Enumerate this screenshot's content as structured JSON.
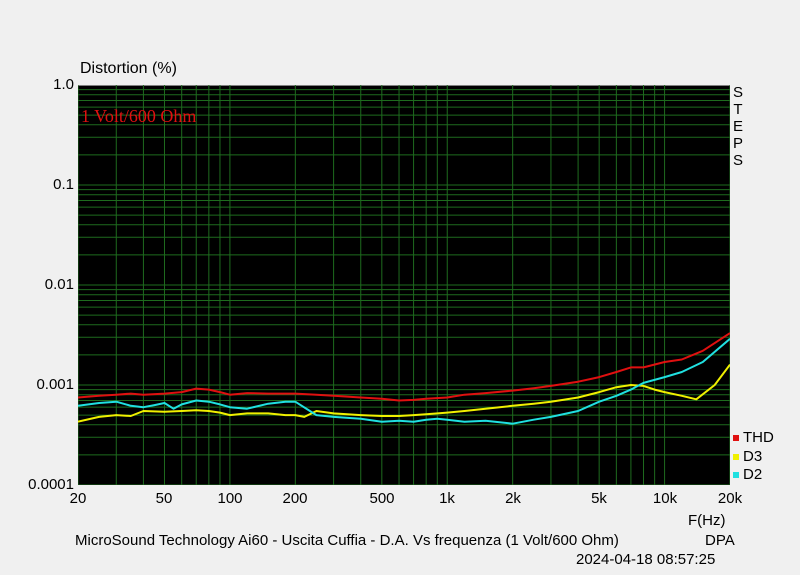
{
  "chart_data": {
    "type": "line",
    "title": "Distortion (%)",
    "annotation": "1 Volt/600 Ohm",
    "xlabel": "F(Hz)",
    "yscale": "log",
    "xscale": "log",
    "xlim": [
      20,
      20000
    ],
    "ylim": [
      0.0001,
      1.0
    ],
    "grid": true,
    "background": "#000000",
    "grid_color": "#1e6b1e",
    "legend_position": "right-bottom",
    "y_ticks": [
      "1.0",
      "0.1",
      "0.01",
      "0.001",
      "0.0001"
    ],
    "x_ticks": [
      "20",
      "50",
      "100",
      "200",
      "500",
      "1k",
      "2k",
      "5k",
      "10k",
      "20k"
    ],
    "x_tick_values": [
      20,
      50,
      100,
      200,
      500,
      1000,
      2000,
      5000,
      10000,
      20000
    ],
    "series": [
      {
        "name": "THD",
        "color": "#e01010",
        "x": [
          20,
          25,
          30,
          35,
          40,
          50,
          60,
          70,
          80,
          90,
          100,
          120,
          150,
          200,
          250,
          300,
          400,
          500,
          600,
          700,
          800,
          1000,
          1200,
          1500,
          2000,
          2500,
          3000,
          4000,
          5000,
          6000,
          7000,
          8000,
          10000,
          12000,
          15000,
          20000
        ],
        "y": [
          0.00075,
          0.00078,
          0.0008,
          0.00082,
          0.0008,
          0.00082,
          0.00085,
          0.00092,
          0.0009,
          0.00085,
          0.0008,
          0.00083,
          0.00082,
          0.00082,
          0.0008,
          0.00078,
          0.00075,
          0.00073,
          0.0007,
          0.00071,
          0.00073,
          0.00075,
          0.0008,
          0.00083,
          0.00088,
          0.00093,
          0.00098,
          0.00108,
          0.0012,
          0.00135,
          0.0015,
          0.0015,
          0.0017,
          0.0018,
          0.0022,
          0.0033
        ]
      },
      {
        "name": "D3",
        "color": "#f0f000",
        "x": [
          20,
          25,
          30,
          35,
          40,
          50,
          60,
          70,
          80,
          90,
          100,
          120,
          150,
          180,
          200,
          220,
          250,
          300,
          400,
          500,
          600,
          700,
          800,
          1000,
          1200,
          1500,
          2000,
          2500,
          3000,
          4000,
          5000,
          6000,
          7000,
          8000,
          9000,
          10000,
          12000,
          14000,
          17000,
          20000
        ],
        "y": [
          0.00043,
          0.00048,
          0.0005,
          0.00049,
          0.00055,
          0.00054,
          0.00055,
          0.00056,
          0.00055,
          0.00053,
          0.0005,
          0.00052,
          0.00052,
          0.0005,
          0.0005,
          0.00048,
          0.00055,
          0.00052,
          0.0005,
          0.00049,
          0.00049,
          0.0005,
          0.00051,
          0.00053,
          0.00055,
          0.00058,
          0.00062,
          0.00065,
          0.00068,
          0.00075,
          0.00085,
          0.00095,
          0.001,
          0.00098,
          0.0009,
          0.00085,
          0.00078,
          0.00072,
          0.001,
          0.0016
        ]
      },
      {
        "name": "D2",
        "color": "#20e0e0",
        "x": [
          20,
          25,
          30,
          35,
          40,
          45,
          50,
          55,
          60,
          70,
          80,
          90,
          100,
          120,
          150,
          180,
          200,
          250,
          300,
          400,
          500,
          600,
          700,
          800,
          900,
          1000,
          1200,
          1500,
          2000,
          2500,
          3000,
          4000,
          5000,
          6000,
          7000,
          8000,
          10000,
          12000,
          15000,
          20000
        ],
        "y": [
          0.00062,
          0.00066,
          0.00068,
          0.00062,
          0.0006,
          0.00063,
          0.00066,
          0.00058,
          0.00064,
          0.0007,
          0.00068,
          0.00064,
          0.0006,
          0.00058,
          0.00065,
          0.00068,
          0.00068,
          0.0005,
          0.00048,
          0.00046,
          0.00043,
          0.00044,
          0.00043,
          0.00045,
          0.00046,
          0.00045,
          0.00043,
          0.00044,
          0.00041,
          0.00045,
          0.00048,
          0.00055,
          0.00068,
          0.00078,
          0.0009,
          0.00105,
          0.0012,
          0.00135,
          0.0017,
          0.0029
        ]
      }
    ]
  },
  "right_label": [
    "S",
    "T",
    "E",
    "P",
    "S"
  ],
  "caption": "MicroSound Technology Ai60 - Uscita Cuffia - D.A. Vs frequenza (1 Volt/600 Ohm)",
  "brand": "DPA",
  "timestamp": "2024-04-18 08:57:25"
}
